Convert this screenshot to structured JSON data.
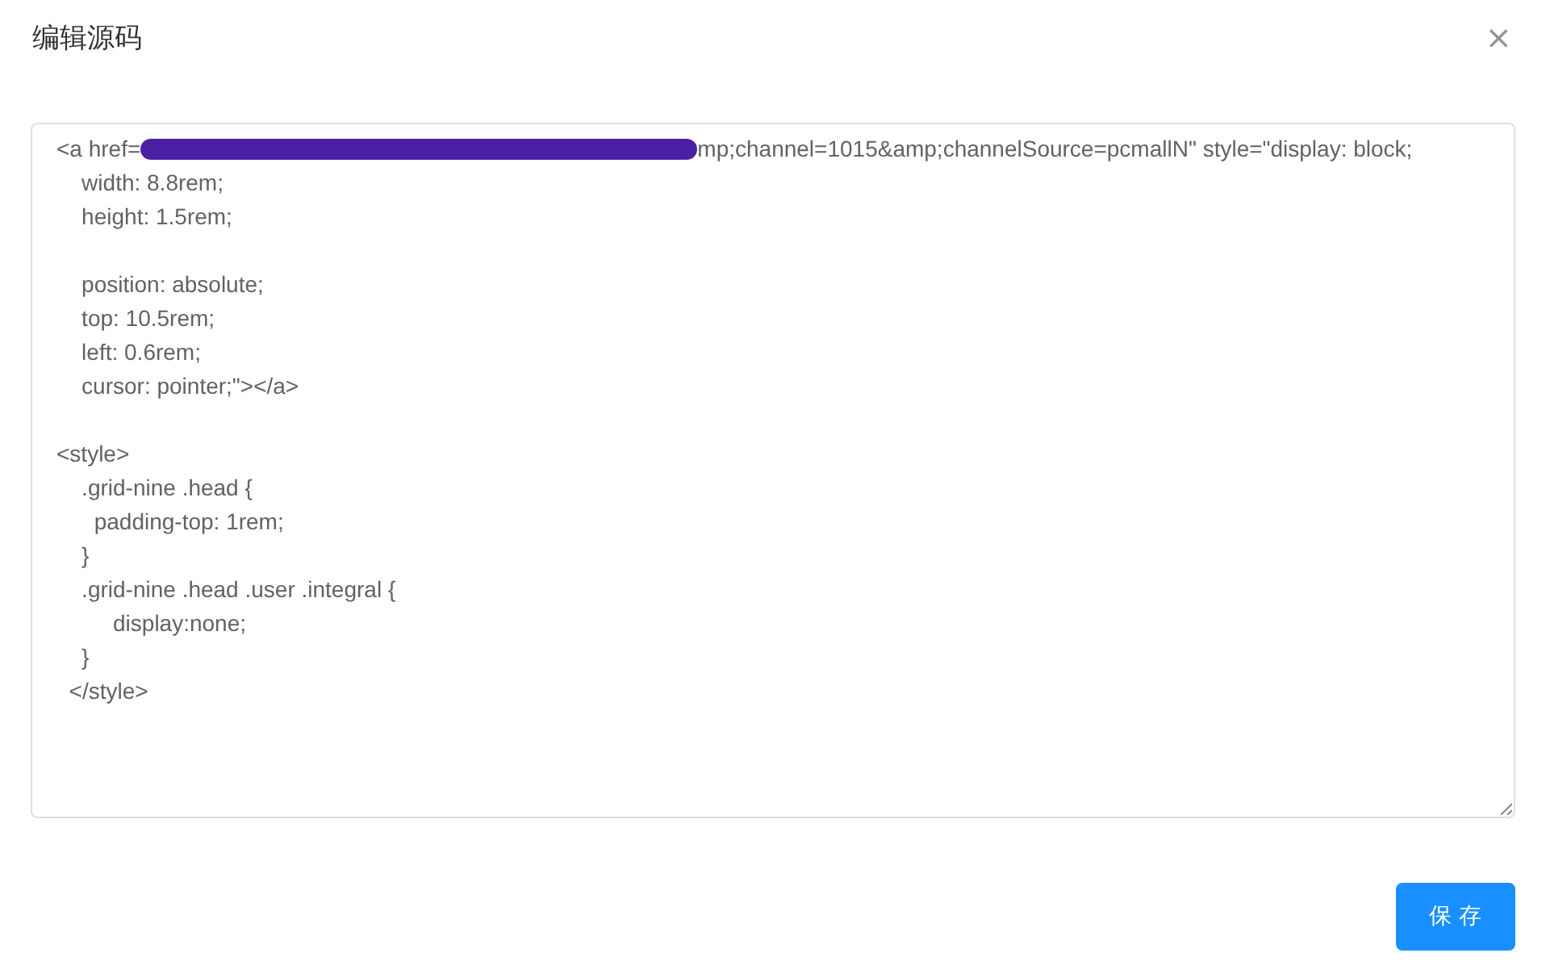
{
  "dialog": {
    "title": "编辑源码",
    "close_icon": "×"
  },
  "editor": {
    "first_line": {
      "before_redaction": "<a href=",
      "after_redaction": "mp;channel=1015&amp;channelSource=pcmallN\" style=\"display: block;"
    },
    "blocks": [
      [
        "    width: 8.8rem;",
        "    height: 1.5rem;"
      ],
      [
        "    position: absolute;",
        "    top: 10.5rem;",
        "    left: 0.6rem;",
        "    cursor: pointer;\"></a>"
      ],
      [
        "<style>",
        "    .grid-nine .head {",
        "      padding-top: 1rem;",
        "    }",
        "    .grid-nine .head .user .integral {",
        "         display:none;",
        "    }",
        "  </style>"
      ]
    ]
  },
  "buttons": [
    {
      "label": "保 存",
      "kind": "primary"
    }
  ]
}
